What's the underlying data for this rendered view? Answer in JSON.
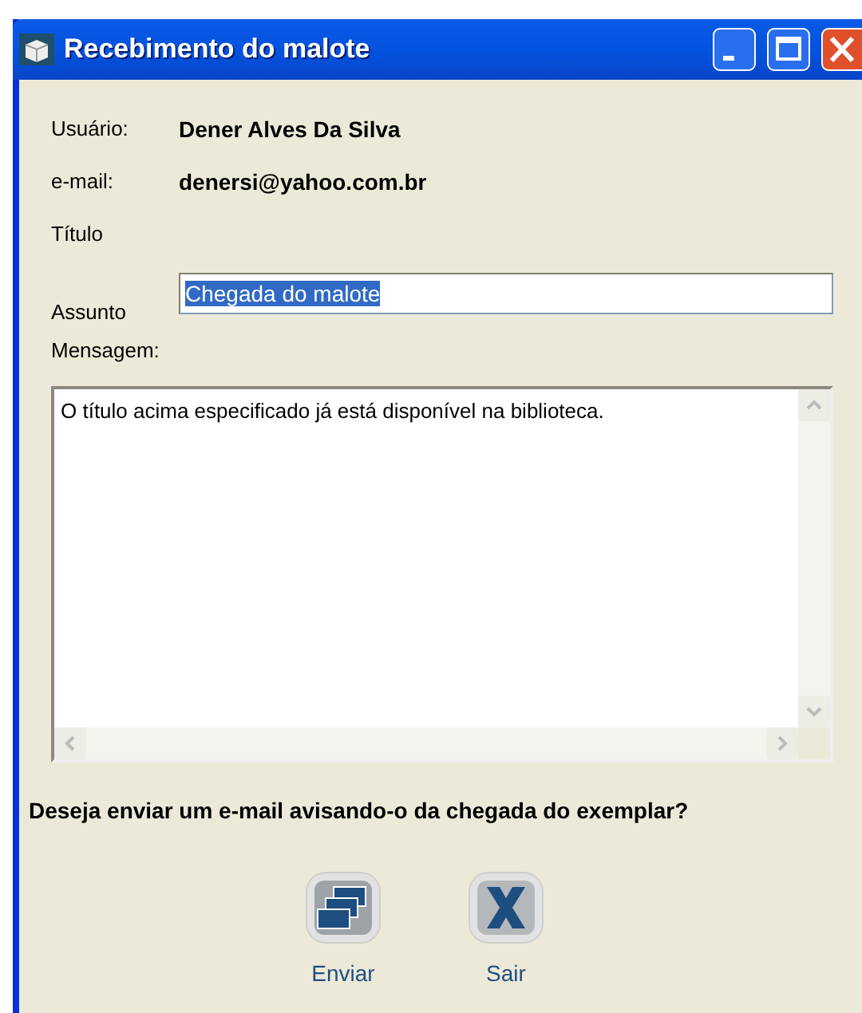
{
  "window": {
    "title": "Recebimento do malote"
  },
  "info": [
    {
      "label": "Usuário:",
      "value": "Dener Alves Da Silva"
    },
    {
      "label": "e-mail:",
      "value": "denersi@yahoo.com.br"
    },
    {
      "label": "Título"
    }
  ],
  "subject": {
    "label": "Assunto",
    "value": "Chegada do malote",
    "selected": true
  },
  "message": {
    "label": "Mensagem:",
    "value": "O título acima especificado já está disponível na biblioteca."
  },
  "question": "Deseja enviar um e-mail avisando-o da chegada do exemplar?",
  "buttons": [
    {
      "kind": "send",
      "label": "Enviar"
    },
    {
      "kind": "exit",
      "label": "Sair"
    }
  ]
}
